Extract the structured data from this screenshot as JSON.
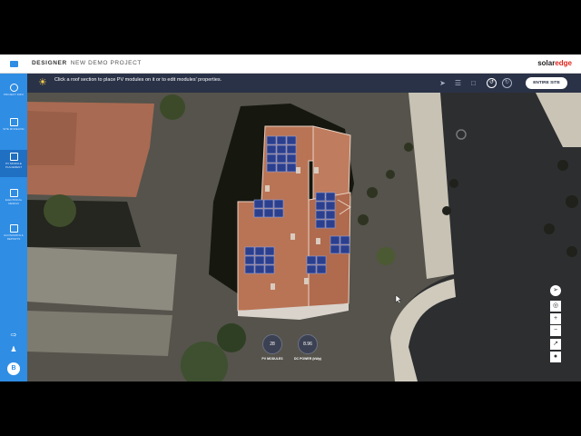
{
  "header": {
    "app_name": "DESIGNER",
    "project_name": "NEW DEMO PROJECT",
    "brand_prefix": "solar",
    "brand_suffix": "edge"
  },
  "sidebar": {
    "items": [
      {
        "label": "PROJECT INFO",
        "icon": "info-icon"
      },
      {
        "label": "SITE MODELING",
        "icon": "home-icon"
      },
      {
        "label": "PV MODULE PLACEMENT",
        "icon": "panel-grid-icon",
        "active": true
      },
      {
        "label": "ELECTRICAL DESIGN",
        "icon": "electrical-icon"
      },
      {
        "label": "ECONOMICS & REPORTS",
        "icon": "report-icon"
      }
    ],
    "user_initial": "B"
  },
  "toolbar": {
    "hint": "Click a roof section to place PV modules on it or to edit modules' properties.",
    "entire_site_label": "ENTIRE SITE"
  },
  "stats": {
    "pv_modules_value": "28",
    "pv_modules_label": "PV MODULES",
    "dc_power_value": "8.96",
    "dc_power_label": "DC POWER (kWp)"
  },
  "colors": {
    "sidebar": "#2f8de4",
    "toolbar": "#2a3247",
    "roof": "#b97456",
    "panel": "#2b3f8f",
    "brand_red": "#e2231a"
  }
}
